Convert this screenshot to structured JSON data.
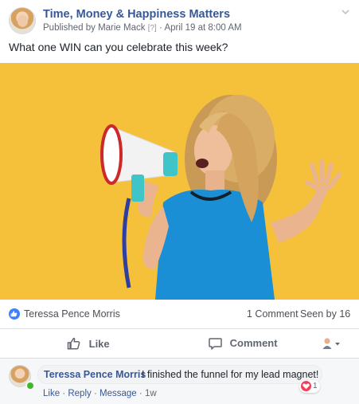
{
  "post": {
    "group_name": "Time, Money & Happiness Matters",
    "published_prefix": "Published by",
    "publisher": "Marie Mack",
    "publisher_help": "[?]",
    "separator": "·",
    "date": "April 19 at 8:00 AM",
    "message": "What one WIN can you celebrate this week?"
  },
  "stats": {
    "liker": "Teressa Pence Morris",
    "comment_count": "1 Comment",
    "seen_by": "Seen by 16"
  },
  "actions": {
    "like_label": "Like",
    "comment_label": "Comment"
  },
  "comment": {
    "author": "Teressa Pence Morris",
    "text": "I finished the funnel for my lead magnet!",
    "like_link": "Like",
    "reply_link": "Reply",
    "message_link": "Message",
    "dot": "·",
    "age": "1w",
    "reaction_count": "1"
  },
  "colors": {
    "brand_blue": "#365899",
    "photo_background": "#f6c13a",
    "top_dress": "#1b8fd6",
    "heart_reaction": "#f33e58",
    "online_status": "#42b72a"
  },
  "icons": {
    "like_badge": "thumbs-up-icon",
    "like_action": "thumbs-up-outline-icon",
    "comment_action": "speech-bubble-icon",
    "menu": "chevron-down-icon",
    "reaction": "heart-icon"
  }
}
